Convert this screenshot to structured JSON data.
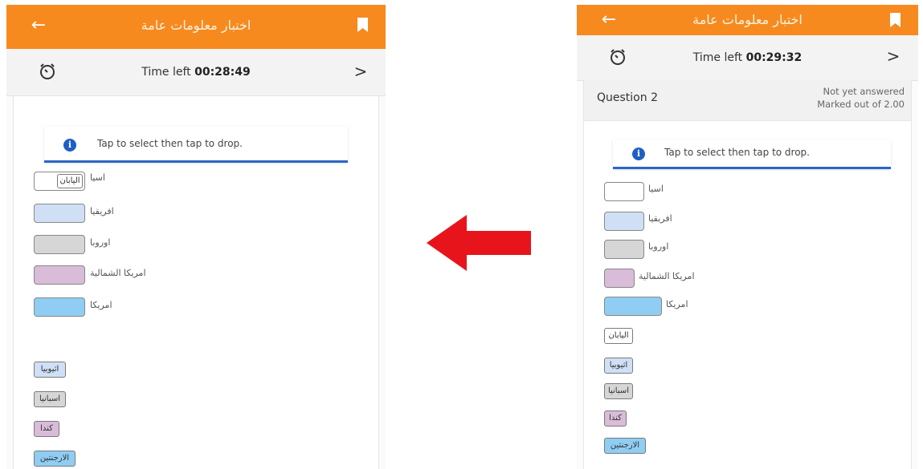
{
  "app": {
    "title": "اختبار معلومات عامة",
    "back_icon": "back-arrow-icon",
    "bookmark_icon": "bookmark-icon",
    "accent_color": "#f68a1f"
  },
  "left_screen": {
    "timer": {
      "label": "Time left",
      "value": "00:28:49"
    },
    "info_text": "Tap to select then tap to drop.",
    "targets": [
      {
        "label": "اسيا",
        "filled": "اليابان"
      },
      {
        "label": "افريقيا"
      },
      {
        "label": "اوروبا"
      },
      {
        "label": "امريكا الشمالية"
      },
      {
        "label": "امريكا"
      }
    ],
    "drag_items": [
      "اثيوبيا",
      "اسبانيا",
      "كندا",
      "الارجنتين"
    ]
  },
  "right_screen": {
    "timer": {
      "label": "Time left",
      "value": "00:29:32"
    },
    "question": {
      "label": "Question 2",
      "status": "Not yet answered",
      "marks": "Marked out of 2.00"
    },
    "info_text": "Tap to select then tap to drop.",
    "targets": [
      {
        "label": "اسيا"
      },
      {
        "label": "افريقيا"
      },
      {
        "label": "اوروبا"
      },
      {
        "label": "امريكا الشمالية"
      },
      {
        "label": "امريكا"
      }
    ],
    "drag_items": [
      "اليابان",
      "اثيوبيا",
      "اسبانيا",
      "كندا",
      "الارجنتين"
    ]
  },
  "transition_arrow": {
    "icon": "left-arrow-icon",
    "color": "#e8141b"
  }
}
